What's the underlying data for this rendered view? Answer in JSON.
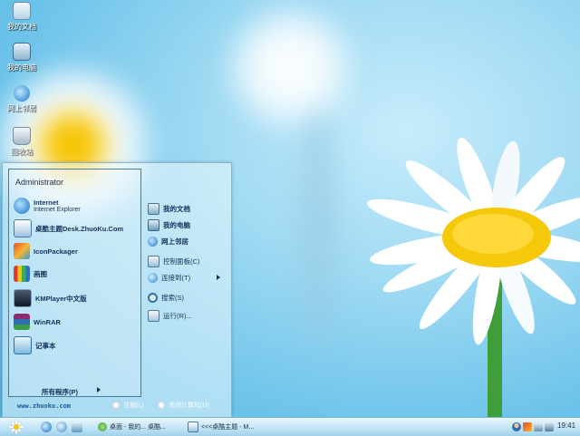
{
  "desktop": {
    "icons": [
      {
        "label": "我的文档",
        "name": "my-documents"
      },
      {
        "label": "我的电脑",
        "name": "my-computer"
      },
      {
        "label": "网上邻居",
        "name": "network-places"
      },
      {
        "label": "回收站",
        "name": "recycle-bin"
      }
    ]
  },
  "start_menu": {
    "user": "Administrator",
    "programs": [
      {
        "label": "Internet",
        "sub": "Internet Explorer",
        "icon": "internet-explorer-icon"
      },
      {
        "label": "桌酷主题Desk.ZhuoKu.Com",
        "sub": "",
        "icon": "zhuoku-theme-icon"
      },
      {
        "label": "IconPackager",
        "sub": "",
        "icon": "iconpackager-icon"
      },
      {
        "label": "画图",
        "sub": "",
        "icon": "paint-icon"
      },
      {
        "label": "KMPlayer中文版",
        "sub": "",
        "icon": "kmplayer-icon"
      },
      {
        "label": "WinRAR",
        "sub": "",
        "icon": "winrar-icon"
      },
      {
        "label": "记事本",
        "sub": "",
        "icon": "notepad-icon"
      }
    ],
    "all_programs": "所有程序(P)",
    "right_items": [
      {
        "label": "我的文档",
        "icon": "documents-icon",
        "bold": true
      },
      {
        "label": "我的电脑",
        "icon": "computer-icon",
        "bold": true
      },
      {
        "label": "网上邻居",
        "icon": "network-icon",
        "bold": true
      },
      {
        "label": "控制面板(C)",
        "icon": "control-panel-icon",
        "bold": false
      },
      {
        "label": "连接到(T)",
        "icon": "connect-icon",
        "bold": false
      },
      {
        "label": "搜索(S)",
        "icon": "search-icon",
        "bold": false
      },
      {
        "label": "运行(R)...",
        "icon": "run-icon",
        "bold": false
      }
    ],
    "website": "www.zhuoku.com",
    "logoff": "注销(L)",
    "shutdown": "关闭计算机(U)"
  },
  "taskbar": {
    "tasks": [
      {
        "label": "桌面 - 我的... 桌酷...",
        "icon": "desktop-task-icon"
      },
      {
        "label": "<<<桌酷主题 - M...",
        "icon": "zhuoku-task-icon"
      }
    ],
    "clock": "19:41"
  },
  "colors": {
    "sky": "#6cc3ea",
    "petal": "#ffffff",
    "center": "#f5c80a",
    "stem": "#3f9d3a",
    "menu_text": "#13325e"
  }
}
